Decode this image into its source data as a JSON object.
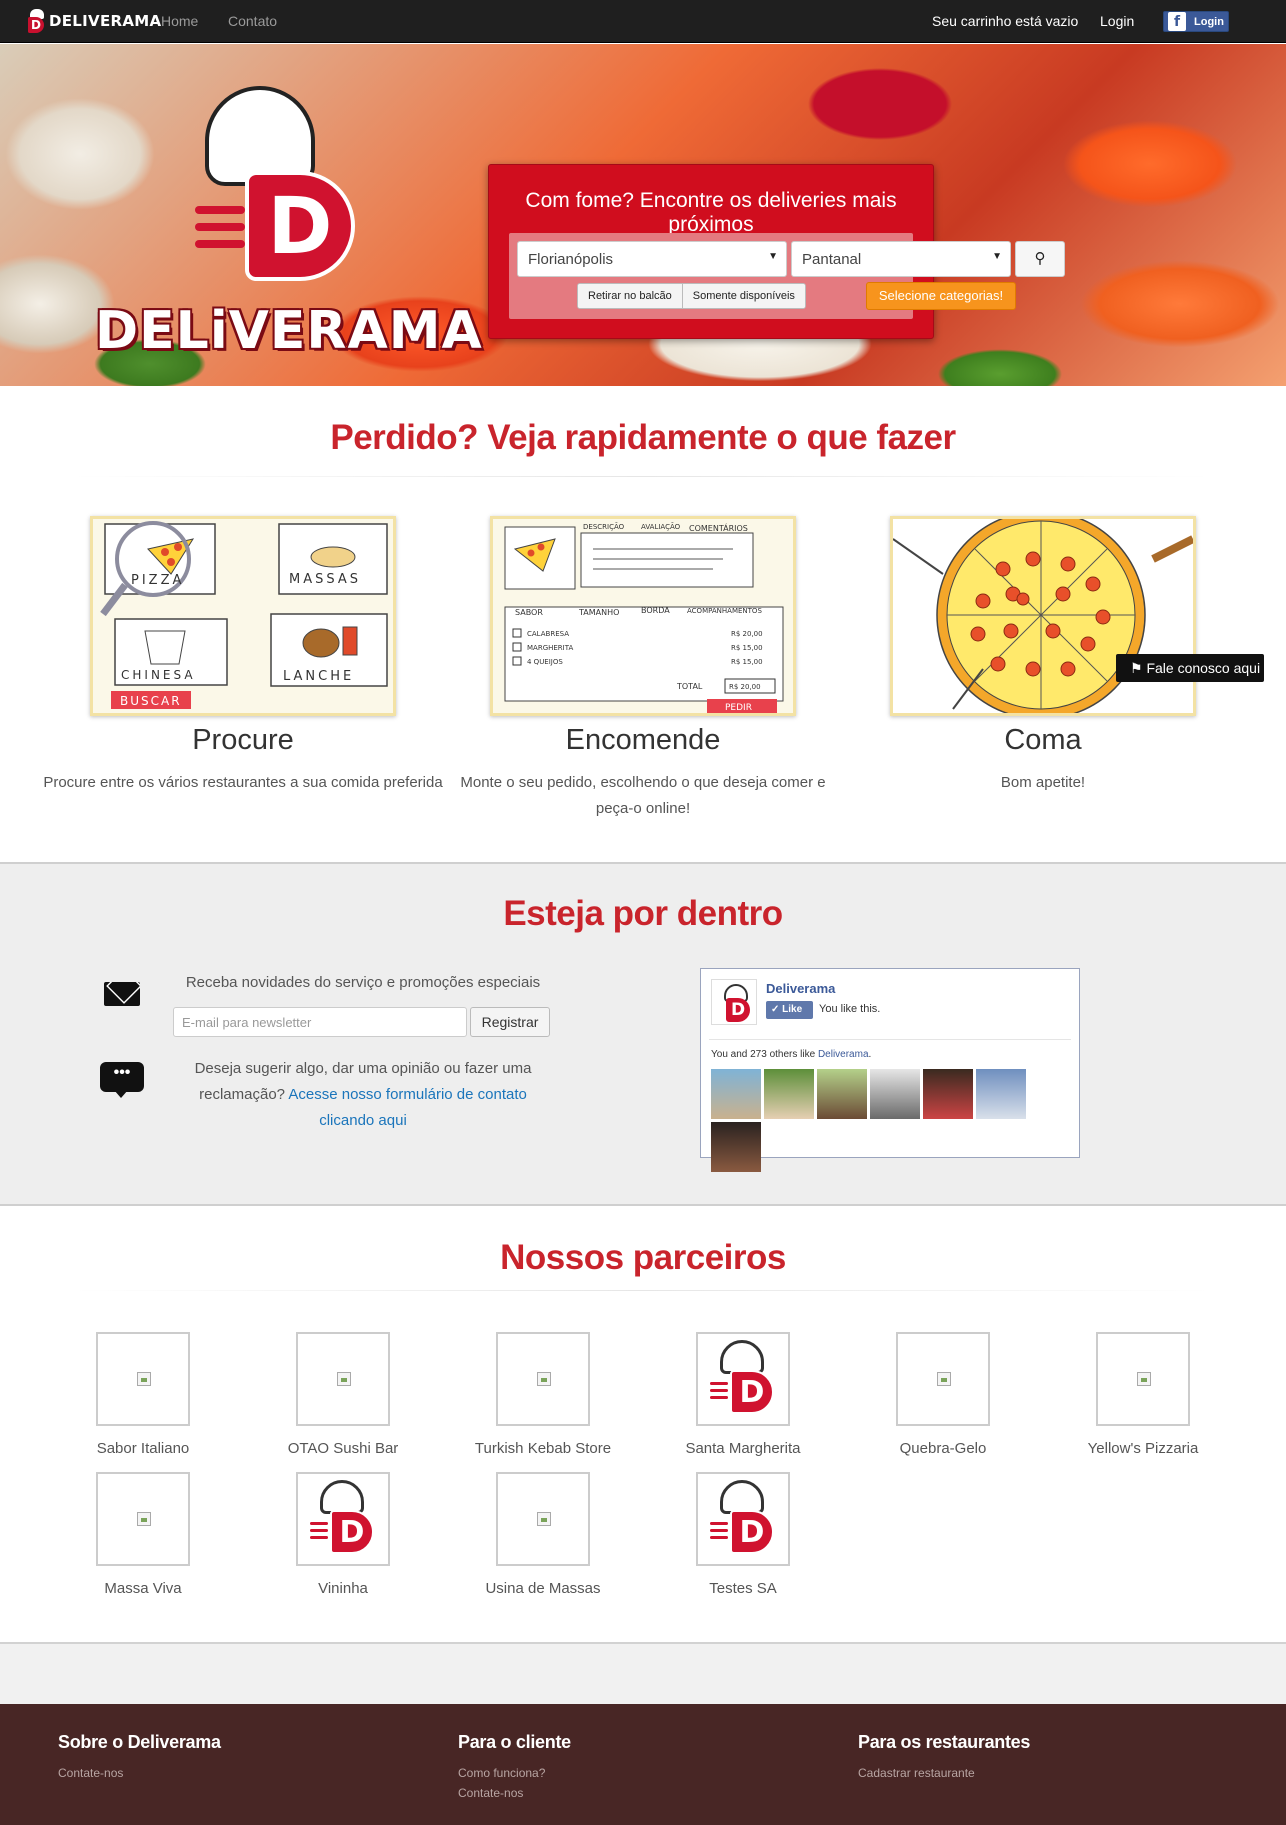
{
  "nav": {
    "brand": "DELIVERAMA",
    "links": [
      "Home",
      "Contato"
    ],
    "cart_status": "Seu carrinho está vazio",
    "login": "Login",
    "fb_login": "Login"
  },
  "hero": {
    "logo_text": "DELiVERAMA",
    "search": {
      "title": "Com fome? Encontre os deliveries mais próximos",
      "city": "Florianópolis",
      "neighborhood": "Pantanal",
      "toggle_pickup": "Retirar no balcão",
      "toggle_available": "Somente disponíveis",
      "categories_button": "Selecione categorias!"
    }
  },
  "how": {
    "title": "Perdido? Veja rapidamente o que fazer",
    "steps": [
      {
        "title": "Procure",
        "text": "Procure entre os vários restaurantes a sua comida preferida"
      },
      {
        "title": "Encomende",
        "text": "Monte o seu pedido, escolhendo o que deseja comer e peça-o online!"
      },
      {
        "title": "Coma",
        "text": "Bom apetite!"
      }
    ],
    "illustration1": {
      "labels": [
        "PIZZA",
        "MASSAS",
        "CHINESA",
        "LANCHE"
      ],
      "button": "BUSCAR"
    },
    "illustration2": {
      "tabs": [
        "DESCRIÇÃO",
        "AVALIAÇÃO",
        "COMENTÁRIOS"
      ],
      "columns": [
        "SABOR",
        "TAMANHO",
        "BORDA",
        "ACOMPANHAMENTOS"
      ],
      "options": [
        "CALABRESA",
        "MARGHERITA",
        "4 QUEIJOS"
      ],
      "prices": [
        "R$ 20,00",
        "R$ 15,00",
        "R$ 15,00"
      ],
      "total_label": "TOTAL",
      "total": "R$ 20,00",
      "button": "PEDIR"
    }
  },
  "contact_tab": "Fale conosco aqui",
  "news": {
    "title": "Esteja por dentro",
    "newsletter_text": "Receba novidades do serviço e promoções especiais",
    "email_placeholder": "E-mail para newsletter",
    "register_button": "Registrar",
    "feedback_text": "Deseja sugerir algo, dar uma opinião ou fazer uma reclamação?",
    "feedback_link": "Acesse nosso formulário de contato clicando aqui",
    "fb": {
      "page_name": "Deliverama",
      "like_button": "Like",
      "like_status": "You like this.",
      "count_prefix": "You and 273 others like",
      "count_link": "Deliverama",
      "count_suffix": "."
    }
  },
  "partners": {
    "title": "Nossos parceiros",
    "items": [
      {
        "name": "Sabor Italiano",
        "logo": "broken-image"
      },
      {
        "name": "OTAO Sushi Bar",
        "logo": "broken-image"
      },
      {
        "name": "Turkish Kebab Store",
        "logo": "broken-image"
      },
      {
        "name": "Santa Margherita",
        "logo": "deliverama-logo"
      },
      {
        "name": "Quebra-Gelo",
        "logo": "broken-image"
      },
      {
        "name": "Yellow's Pizzaria",
        "logo": "broken-image"
      },
      {
        "name": "Massa Viva",
        "logo": "broken-image"
      },
      {
        "name": "Vininha",
        "logo": "deliverama-logo"
      },
      {
        "name": "Usina de Massas",
        "logo": "broken-image"
      },
      {
        "name": "Testes SA",
        "logo": "deliverama-logo"
      }
    ]
  },
  "footer": {
    "columns": [
      {
        "title": "Sobre o Deliverama",
        "links": [
          "Contate-nos"
        ]
      },
      {
        "title": "Para o cliente",
        "links": [
          "Como funciona?",
          "Contate-nos"
        ]
      },
      {
        "title": "Para os restaurantes",
        "links": [
          "Cadastrar restaurante"
        ]
      }
    ]
  },
  "colors": {
    "brand_red": "#c9242c",
    "search_red": "#d00d1e",
    "orange_button": "#f7941d",
    "footer_bg": "#482625",
    "facebook_blue": "#3b5998"
  }
}
